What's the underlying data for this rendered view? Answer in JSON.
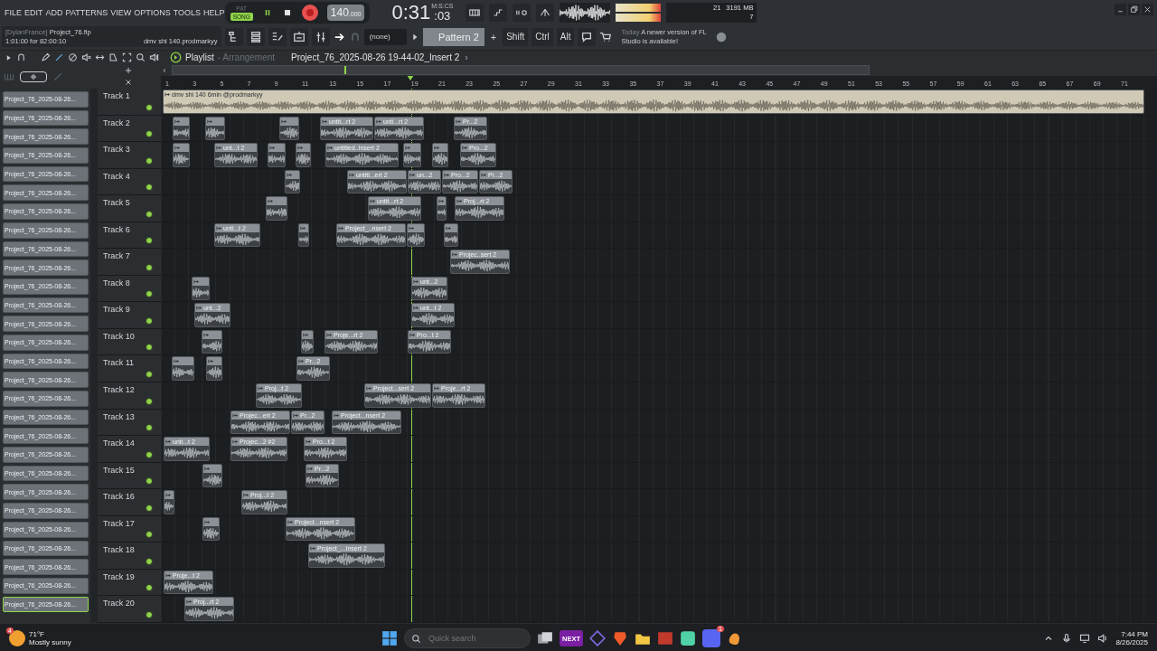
{
  "menu": [
    "FILE",
    "EDIT",
    "ADD",
    "PATTERNS",
    "VIEW",
    "OPTIONS",
    "TOOLS",
    "HELP"
  ],
  "transport": {
    "modes": [
      {
        "label": "PAT",
        "selected": false
      },
      {
        "label": "SONG",
        "selected": true
      }
    ],
    "tempo": "140",
    "tempo_fraction": ".000",
    "time": "0:31",
    "time_centis": ":03",
    "time_unit": "M:S:CS"
  },
  "hint": {
    "user": "[DylanFrance]",
    "project": "Project_76.flp",
    "position": "1:01:00 for 82:00:10",
    "pattern_name": "dmv shi 140.prodmarkyy"
  },
  "toolbar": {
    "channel": "(none)",
    "pattern": "Pattern 2",
    "add": "+",
    "keys": [
      "Shift",
      "Ctrl",
      "Alt"
    ],
    "news_day": "Today",
    "news_text": "A newer version of FL Studio is available!"
  },
  "monitor": {
    "polyphony": "21",
    "memory": "3191 MB",
    "cpu": "7"
  },
  "playlist": {
    "title": "Playlist",
    "view": "- Arrangement",
    "clip_source": "Project_76_2025-08-26 19-44-02_Insert 2"
  },
  "browser": {
    "items": [
      {
        "label": "Project_76_2025-08-26...",
        "selected": false
      },
      {
        "label": "Project_76_2025-08-26...",
        "selected": false
      },
      {
        "label": "Project_76_2025-08-26...",
        "selected": false
      },
      {
        "label": "Project_76_2025-08-26...",
        "selected": false
      },
      {
        "label": "Project_76_2025-08-26...",
        "selected": false
      },
      {
        "label": "Project_76_2025-08-26...",
        "selected": false
      },
      {
        "label": "Project_76_2025-08-26...",
        "selected": false
      },
      {
        "label": "Project_76_2025-08-26...",
        "selected": false
      },
      {
        "label": "Project_76_2025-08-26...",
        "selected": false
      },
      {
        "label": "Project_76_2025-08-26...",
        "selected": false
      },
      {
        "label": "Project_76_2025-08-26...",
        "selected": false
      },
      {
        "label": "Project_76_2025-08-26...",
        "selected": false
      },
      {
        "label": "Project_76_2025-08-26...",
        "selected": false
      },
      {
        "label": "Project_76_2025-08-26...",
        "selected": false
      },
      {
        "label": "Project_76_2025-08-26...",
        "selected": false
      },
      {
        "label": "Project_76_2025-08-26...",
        "selected": false
      },
      {
        "label": "Project_76_2025-08-26...",
        "selected": false
      },
      {
        "label": "Project_76_2025-08-26...",
        "selected": false
      },
      {
        "label": "Project_76_2025-08-26...",
        "selected": false
      },
      {
        "label": "Project_76_2025-08-26...",
        "selected": false
      },
      {
        "label": "Project_76_2025-08-26...",
        "selected": false
      },
      {
        "label": "Project_76_2025-08-26...",
        "selected": false
      },
      {
        "label": "Project_76_2025-08-26...",
        "selected": false
      },
      {
        "label": "Project_76_2025-08-26...",
        "selected": false
      },
      {
        "label": "Project_76_2025-08-26...",
        "selected": false
      },
      {
        "label": "Project_76_2025-08-26...",
        "selected": false
      },
      {
        "label": "Project_76_2025-08-26...",
        "selected": false
      },
      {
        "label": "Project_76_2025-08-26...",
        "selected": true
      }
    ]
  },
  "ruler": [
    "1",
    "3",
    "5",
    "7",
    "9",
    "11",
    "13",
    "15",
    "17",
    "19",
    "21",
    "23",
    "25",
    "27",
    "29",
    "31",
    "33",
    "35",
    "37",
    "39",
    "41",
    "43",
    "45",
    "47",
    "49",
    "51",
    "53",
    "55",
    "57",
    "59",
    "61",
    "63",
    "65",
    "67",
    "69",
    "71"
  ],
  "tracks": [
    {
      "name": "Track 1",
      "enabled": true,
      "clips": [
        {
          "label": "dmv shi 140 6min @prodmarkyy",
          "color": "#cfc9b6"
        }
      ]
    },
    {
      "name": "Track 2",
      "enabled": true,
      "clips": [
        {
          "color": "#8c9197"
        },
        {
          "color": "#8c9197"
        },
        {
          "color": "#8c9197"
        },
        {
          "label": "untit...rt 2",
          "color": "#8c9197"
        },
        {
          "label": "unti...rt 2",
          "color": "#8c9197"
        },
        {
          "label": "Pr...2",
          "color": "#8c9197"
        }
      ]
    },
    {
      "name": "Track 3",
      "enabled": true,
      "clips": [
        {
          "color": "#8c9197"
        },
        {
          "label": "unt...t 2",
          "color": "#8c9197"
        },
        {
          "color": "#8c9197"
        },
        {
          "color": "#8c9197"
        },
        {
          "label": "untitled..Insert 2",
          "color": "#8c9197"
        },
        {
          "color": "#8c9197"
        },
        {
          "color": "#8c9197"
        },
        {
          "label": "Pro...2",
          "color": "#8c9197"
        }
      ]
    },
    {
      "name": "Track 4",
      "enabled": true,
      "clips": [
        {
          "color": "#8c9197"
        },
        {
          "label": "untitl...ert 2",
          "color": "#8c9197"
        },
        {
          "label": "un...2",
          "color": "#8c9197"
        },
        {
          "label": "Pro...2",
          "color": "#8c9197"
        },
        {
          "label": "Pr...2",
          "color": "#8c9197"
        }
      ]
    },
    {
      "name": "Track 5",
      "enabled": true,
      "clips": [
        {
          "color": "#8c9197"
        },
        {
          "label": "untit...rt 2",
          "color": "#8c9197"
        },
        {
          "color": "#8c9197"
        },
        {
          "label": "Proj...rt 2",
          "color": "#8c9197"
        }
      ]
    },
    {
      "name": "Track 6",
      "enabled": true,
      "clips": [
        {
          "label": "unti...t 2",
          "color": "#8c9197"
        },
        {
          "color": "#8c9197"
        },
        {
          "label": "Project_..nsert 2",
          "color": "#8c9197"
        },
        {
          "color": "#8c9197"
        },
        {
          "color": "#8c9197"
        }
      ]
    },
    {
      "name": "Track 7",
      "enabled": true,
      "clips": [
        {
          "label": "Projec..sert 2",
          "color": "#8c9197"
        }
      ]
    },
    {
      "name": "Track 8",
      "enabled": true,
      "clips": [
        {
          "color": "#8c9197"
        },
        {
          "label": "unt...2",
          "color": "#8c9197"
        }
      ]
    },
    {
      "name": "Track 9",
      "enabled": true,
      "clips": [
        {
          "label": "unt...2",
          "color": "#8c9197"
        },
        {
          "label": "unt...t 2",
          "color": "#8c9197"
        }
      ]
    },
    {
      "name": "Track 10",
      "enabled": true,
      "clips": [
        {
          "color": "#8c9197"
        },
        {
          "color": "#8c9197"
        },
        {
          "label": "Proje...rt 2",
          "color": "#8c9197"
        },
        {
          "label": "Pro...t 2",
          "color": "#8c9197"
        }
      ]
    },
    {
      "name": "Track 11",
      "enabled": true,
      "clips": [
        {
          "color": "#8c9197"
        },
        {
          "color": "#8c9197"
        },
        {
          "label": "Pr...2",
          "color": "#8c9197"
        }
      ]
    },
    {
      "name": "Track 12",
      "enabled": true,
      "clips": [
        {
          "label": "Proj...t 2",
          "color": "#8c9197"
        },
        {
          "label": "Project...sert 2",
          "color": "#8c9197"
        },
        {
          "label": "Proje...rt 2",
          "color": "#8c9197"
        }
      ]
    },
    {
      "name": "Track 13",
      "enabled": true,
      "clips": [
        {
          "label": "Projec...ert 2",
          "color": "#8c9197"
        },
        {
          "label": "Pr...2",
          "color": "#8c9197"
        },
        {
          "label": "Project...nsert 2",
          "color": "#8c9197"
        }
      ]
    },
    {
      "name": "Track 14",
      "enabled": true,
      "clips": [
        {
          "label": "unti...t 2",
          "color": "#8c9197"
        },
        {
          "label": "Projec...2 #2",
          "color": "#8c9197"
        },
        {
          "label": "Pro...t 2",
          "color": "#8c9197"
        }
      ]
    },
    {
      "name": "Track 15",
      "enabled": true,
      "clips": [
        {
          "color": "#8c9197"
        },
        {
          "label": "Pr...2",
          "color": "#8c9197"
        }
      ]
    },
    {
      "name": "Track 16",
      "enabled": true,
      "clips": [
        {
          "color": "#8c9197"
        },
        {
          "label": "Proj...t 2",
          "color": "#8c9197"
        }
      ]
    },
    {
      "name": "Track 17",
      "enabled": true,
      "clips": [
        {
          "color": "#8c9197"
        },
        {
          "label": "Project...nsert 2",
          "color": "#8c9197"
        }
      ]
    },
    {
      "name": "Track 18",
      "enabled": true,
      "clips": [
        {
          "label": "Project_...Insert 2",
          "color": "#8c9197"
        }
      ]
    },
    {
      "name": "Track 19",
      "enabled": true,
      "clips": [
        {
          "label": "Proje...t 2",
          "color": "#8c9197"
        }
      ]
    },
    {
      "name": "Track 20",
      "enabled": true,
      "clips": [
        {
          "label": "Proj...rt 2",
          "color": "#8c9197"
        }
      ]
    }
  ],
  "taskbar": {
    "temperature": "71°F",
    "condition": "Mostly sunny",
    "weather_badge": "4",
    "search_placeholder": "Quick search",
    "app_label": "NEXT",
    "chat_badge": "1",
    "time": "7:44 PM",
    "date": "8/26/2025"
  }
}
